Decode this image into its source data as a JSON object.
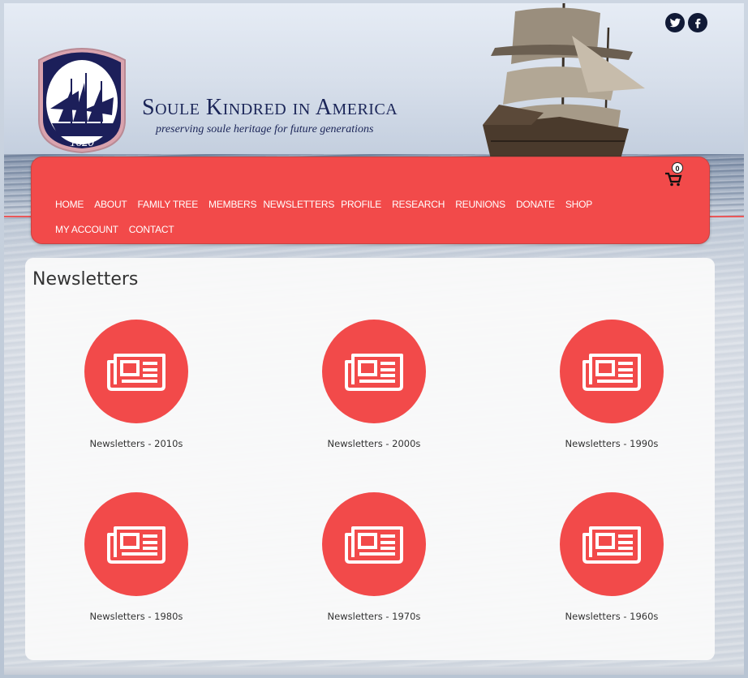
{
  "header": {
    "site_title": "Soule Kindred in America",
    "tagline": "preserving soule heritage for future generations",
    "logo_year": "1620",
    "social": [
      {
        "icon": "twitter-icon"
      },
      {
        "icon": "facebook-icon"
      }
    ]
  },
  "nav": {
    "items": [
      {
        "label": "HOME"
      },
      {
        "label": "ABOUT"
      },
      {
        "label": "FAMILY TREE"
      },
      {
        "label": "MEMBERS"
      },
      {
        "label": "NEWSLETTERS"
      },
      {
        "label": "PROFILE"
      },
      {
        "label": "RESEARCH"
      },
      {
        "label": "REUNIONS"
      },
      {
        "label": "DONATE"
      },
      {
        "label": "SHOP"
      },
      {
        "label": "MY ACCOUNT"
      },
      {
        "label": "CONTACT"
      }
    ],
    "cart_count": "0"
  },
  "main": {
    "title": "Newsletters",
    "tiles": [
      {
        "label": "Newsletters - 2010s",
        "icon": "newspaper-icon"
      },
      {
        "label": "Newsletters - 2000s",
        "icon": "newspaper-icon"
      },
      {
        "label": "Newsletters - 1990s",
        "icon": "newspaper-icon"
      },
      {
        "label": "Newsletters - 1980s",
        "icon": "newspaper-icon"
      },
      {
        "label": "Newsletters - 1970s",
        "icon": "newspaper-icon"
      },
      {
        "label": "Newsletters - 1960s",
        "icon": "newspaper-icon"
      }
    ]
  },
  "colors": {
    "accent": "#f24a4a",
    "navy": "#1b2558"
  }
}
